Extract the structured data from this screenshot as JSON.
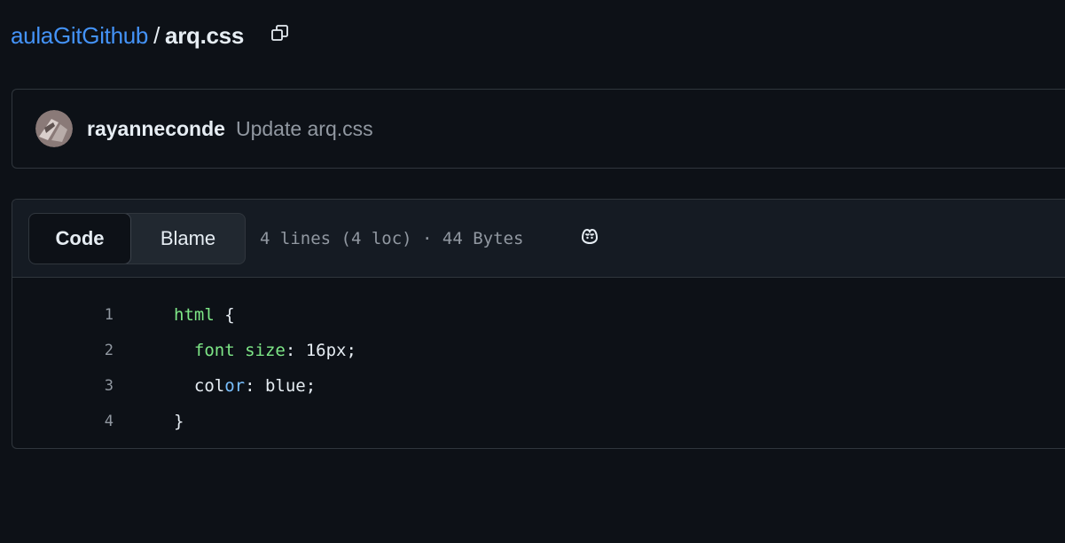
{
  "breadcrumb": {
    "repo": "aulaGitGithub",
    "separator": "/",
    "file": "arq.css"
  },
  "icons": {
    "copy": "copy-icon",
    "copilot": "copilot-icon",
    "avatar": "user-avatar"
  },
  "commit": {
    "author": "rayanneconde",
    "message": "Update arq.css"
  },
  "file_header": {
    "tabs": [
      "Code",
      "Blame"
    ],
    "selected_tab": "Code",
    "meta": "4 lines (4 loc) · 44 Bytes"
  },
  "code": {
    "lines": [
      {
        "number": "1",
        "tokens": [
          {
            "text": "html",
            "kind": "tag"
          },
          {
            "text": " {",
            "kind": "plain"
          }
        ]
      },
      {
        "number": "2",
        "tokens": [
          {
            "text": "  font size",
            "kind": "prop"
          },
          {
            "text": ": 16px;",
            "kind": "plain"
          }
        ]
      },
      {
        "number": "3",
        "tokens": [
          {
            "text": "  col",
            "kind": "plain"
          },
          {
            "text": "or",
            "kind": "blue"
          },
          {
            "text": ": blue;",
            "kind": "plain"
          }
        ]
      },
      {
        "number": "4",
        "tokens": [
          {
            "text": "}",
            "kind": "plain"
          }
        ]
      }
    ]
  },
  "colors": {
    "background": "#0d1117",
    "link": "#4493f8",
    "border": "#30363d",
    "muted": "#9198a1",
    "syntax_green": "#7ee787",
    "syntax_blue": "#79c0ff"
  }
}
